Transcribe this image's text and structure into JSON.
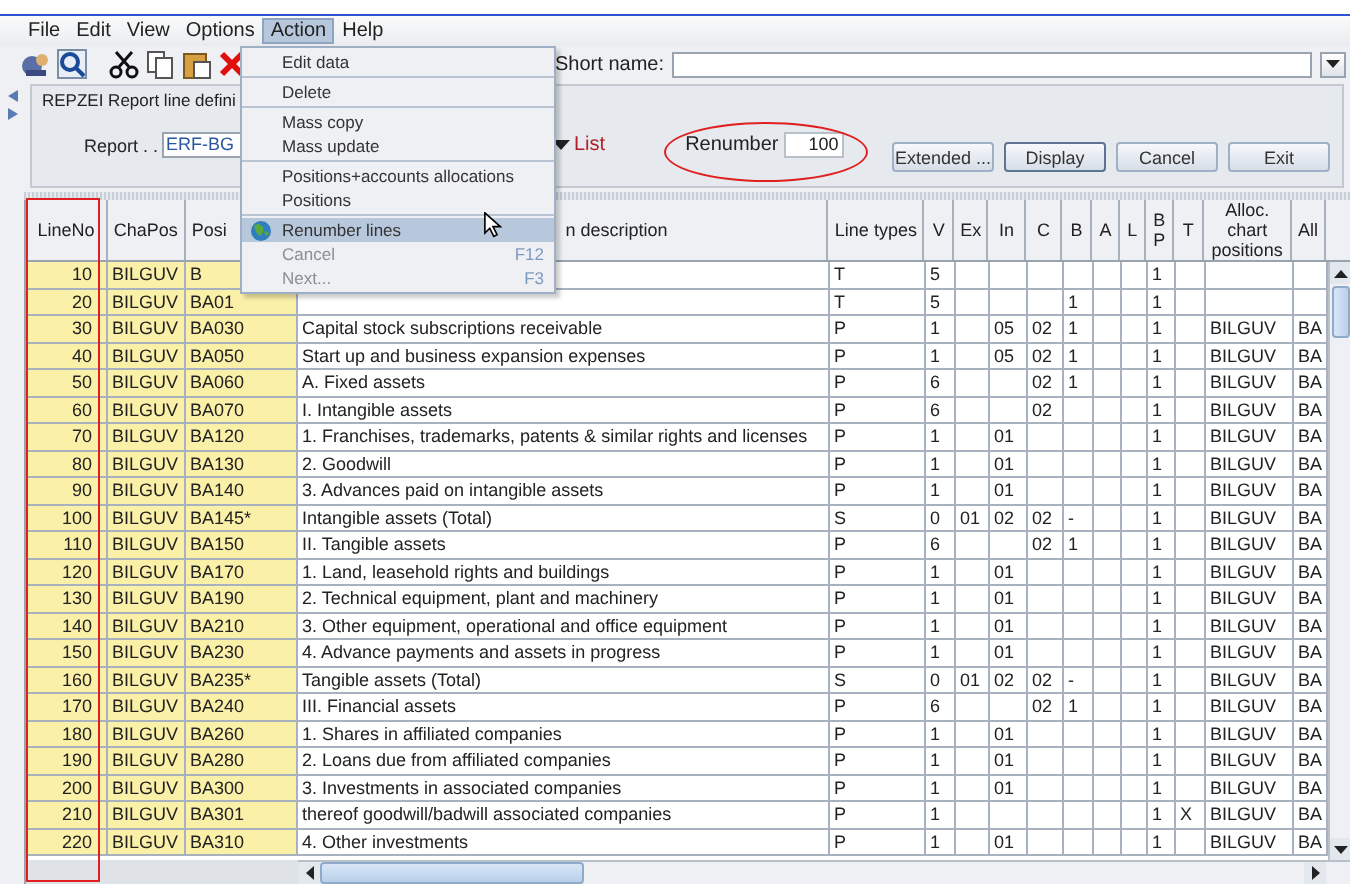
{
  "menu_bar": [
    {
      "label": "File",
      "selected": false
    },
    {
      "label": "Edit",
      "selected": false
    },
    {
      "label": "View",
      "selected": false
    },
    {
      "label": "Options",
      "selected": false
    },
    {
      "label": "Action",
      "selected": true
    },
    {
      "label": "Help",
      "selected": false
    }
  ],
  "toolbar": {
    "short_name_label": "Short name:"
  },
  "panel": {
    "title": "REPZEI Report line defini",
    "report_label": "Report . .",
    "report_value": "ERF-BG",
    "list_link": "List",
    "renumber_label": "Renumber",
    "renumber_value": "100",
    "buttons": [
      {
        "label": "Extended ...",
        "default": false
      },
      {
        "label": "Display",
        "default": true
      },
      {
        "label": "Cancel",
        "default": false
      },
      {
        "label": "Exit",
        "default": false
      }
    ]
  },
  "table": {
    "columns": [
      {
        "label": "LineNo"
      },
      {
        "label": "ChaPos"
      },
      {
        "label": "Posi"
      },
      {
        "label": "n description"
      },
      {
        "label": "Line types"
      },
      {
        "label": "V"
      },
      {
        "label": "Ex"
      },
      {
        "label": "In"
      },
      {
        "label": "C"
      },
      {
        "label": "B"
      },
      {
        "label": "A"
      },
      {
        "label": "L"
      },
      {
        "label": "B P"
      },
      {
        "label": "T"
      },
      {
        "label": "Alloc. chart positions"
      },
      {
        "label": "All"
      }
    ],
    "rows": [
      {
        "line_no": "10",
        "cha_pos": "BILGUV",
        "position": "B",
        "line_type": "T",
        "v": "5",
        "bp": "1"
      },
      {
        "line_no": "20",
        "cha_pos": "BILGUV",
        "position": "BA01",
        "line_type": "T",
        "v": "5",
        "b": "1",
        "bp": "1"
      },
      {
        "line_no": "30",
        "cha_pos": "BILGUV",
        "position": "BA030",
        "description": "Capital stock subscriptions receivable",
        "line_type": "P",
        "v": "1",
        "in": "05",
        "c": "02",
        "b": "1",
        "bp": "1",
        "alloc": "BILGUV",
        "all": "BA"
      },
      {
        "line_no": "40",
        "cha_pos": "BILGUV",
        "position": "BA050",
        "description": "Start up and business expansion expenses",
        "line_type": "P",
        "v": "1",
        "in": "05",
        "c": "02",
        "b": "1",
        "bp": "1",
        "alloc": "BILGUV",
        "all": "BA"
      },
      {
        "line_no": "50",
        "cha_pos": "BILGUV",
        "position": "BA060",
        "description": "A. Fixed assets",
        "line_type": "P",
        "v": "6",
        "c": "02",
        "b": "1",
        "bp": "1",
        "alloc": "BILGUV",
        "all": "BA"
      },
      {
        "line_no": "60",
        "cha_pos": "BILGUV",
        "position": "BA070",
        "description": "I. Intangible assets",
        "line_type": "P",
        "v": "6",
        "c": "02",
        "bp": "1",
        "alloc": "BILGUV",
        "all": "BA"
      },
      {
        "line_no": "70",
        "cha_pos": "BILGUV",
        "position": "BA120",
        "description": "1. Franchises, trademarks, patents & similar rights and licenses",
        "line_type": "P",
        "v": "1",
        "in": "01",
        "bp": "1",
        "alloc": "BILGUV",
        "all": "BA"
      },
      {
        "line_no": "80",
        "cha_pos": "BILGUV",
        "position": "BA130",
        "description": "2. Goodwill",
        "line_type": "P",
        "v": "1",
        "in": "01",
        "bp": "1",
        "alloc": "BILGUV",
        "all": "BA"
      },
      {
        "line_no": "90",
        "cha_pos": "BILGUV",
        "position": "BA140",
        "description": "3. Advances paid on intangible assets",
        "line_type": "P",
        "v": "1",
        "in": "01",
        "bp": "1",
        "alloc": "BILGUV",
        "all": "BA"
      },
      {
        "line_no": "100",
        "cha_pos": "BILGUV",
        "position": "BA145*",
        "description": "Intangible assets (Total)",
        "line_type": "S",
        "v": "0",
        "ex": "01",
        "in": "02",
        "c": "02",
        "b": "-",
        "bp": "1",
        "alloc": "BILGUV",
        "all": "BA"
      },
      {
        "line_no": "110",
        "cha_pos": "BILGUV",
        "position": "BA150",
        "description": "II. Tangible assets",
        "line_type": "P",
        "v": "6",
        "c": "02",
        "b": "1",
        "bp": "1",
        "alloc": "BILGUV",
        "all": "BA"
      },
      {
        "line_no": "120",
        "cha_pos": "BILGUV",
        "position": "BA170",
        "description": "1. Land, leasehold rights and buildings",
        "line_type": "P",
        "v": "1",
        "in": "01",
        "bp": "1",
        "alloc": "BILGUV",
        "all": "BA"
      },
      {
        "line_no": "130",
        "cha_pos": "BILGUV",
        "position": "BA190",
        "description": "2. Technical equipment, plant and machinery",
        "line_type": "P",
        "v": "1",
        "in": "01",
        "bp": "1",
        "alloc": "BILGUV",
        "all": "BA"
      },
      {
        "line_no": "140",
        "cha_pos": "BILGUV",
        "position": "BA210",
        "description": "3. Other equipment, operational and office equipment",
        "line_type": "P",
        "v": "1",
        "in": "01",
        "bp": "1",
        "alloc": "BILGUV",
        "all": "BA"
      },
      {
        "line_no": "150",
        "cha_pos": "BILGUV",
        "position": "BA230",
        "description": "4. Advance payments and assets in progress",
        "line_type": "P",
        "v": "1",
        "in": "01",
        "bp": "1",
        "alloc": "BILGUV",
        "all": "BA"
      },
      {
        "line_no": "160",
        "cha_pos": "BILGUV",
        "position": "BA235*",
        "description": "Tangible assets (Total)",
        "line_type": "S",
        "v": "0",
        "ex": "01",
        "in": "02",
        "c": "02",
        "b": "-",
        "bp": "1",
        "alloc": "BILGUV",
        "all": "BA"
      },
      {
        "line_no": "170",
        "cha_pos": "BILGUV",
        "position": "BA240",
        "description": "III. Financial assets",
        "line_type": "P",
        "v": "6",
        "c": "02",
        "b": "1",
        "bp": "1",
        "alloc": "BILGUV",
        "all": "BA"
      },
      {
        "line_no": "180",
        "cha_pos": "BILGUV",
        "position": "BA260",
        "description": "1. Shares in affiliated companies",
        "line_type": "P",
        "v": "1",
        "in": "01",
        "bp": "1",
        "alloc": "BILGUV",
        "all": "BA"
      },
      {
        "line_no": "190",
        "cha_pos": "BILGUV",
        "position": "BA280",
        "description": "2. Loans due from affiliated companies",
        "line_type": "P",
        "v": "1",
        "in": "01",
        "bp": "1",
        "alloc": "BILGUV",
        "all": "BA"
      },
      {
        "line_no": "200",
        "cha_pos": "BILGUV",
        "position": "BA300",
        "description": "3. Investments in associated companies",
        "line_type": "P",
        "v": "1",
        "in": "01",
        "bp": "1",
        "alloc": "BILGUV",
        "all": "BA"
      },
      {
        "line_no": "210",
        "cha_pos": "BILGUV",
        "position": "BA301",
        "description": "thereof goodwill/badwill associated companies",
        "line_type": "P",
        "v": "1",
        "bp": "1",
        "t": "X",
        "alloc": "BILGUV",
        "all": "BA"
      },
      {
        "line_no": "220",
        "cha_pos": "BILGUV",
        "position": "BA310",
        "description": "4. Other investments",
        "line_type": "P",
        "v": "1",
        "in": "01",
        "bp": "1",
        "alloc": "BILGUV",
        "all": "BA"
      }
    ]
  },
  "action_menu": {
    "groups": [
      [
        {
          "label": "Edit data",
          "selected": false,
          "disabled": false
        }
      ],
      [
        {
          "label": "Delete",
          "selected": false,
          "disabled": false
        }
      ],
      [
        {
          "label": "Mass copy",
          "selected": false,
          "disabled": false
        },
        {
          "label": "Mass update",
          "selected": false,
          "disabled": false
        }
      ],
      [
        {
          "label": "Positions+accounts allocations",
          "selected": false,
          "disabled": false
        },
        {
          "label": "Positions",
          "selected": false,
          "disabled": false
        }
      ],
      [
        {
          "label": "Renumber lines",
          "selected": true,
          "disabled": false,
          "icon": true
        },
        {
          "label": "Cancel",
          "shortcut": "F12",
          "selected": false,
          "disabled": true
        },
        {
          "label": "Next...",
          "shortcut": "F3",
          "selected": false,
          "disabled": true
        }
      ]
    ]
  }
}
